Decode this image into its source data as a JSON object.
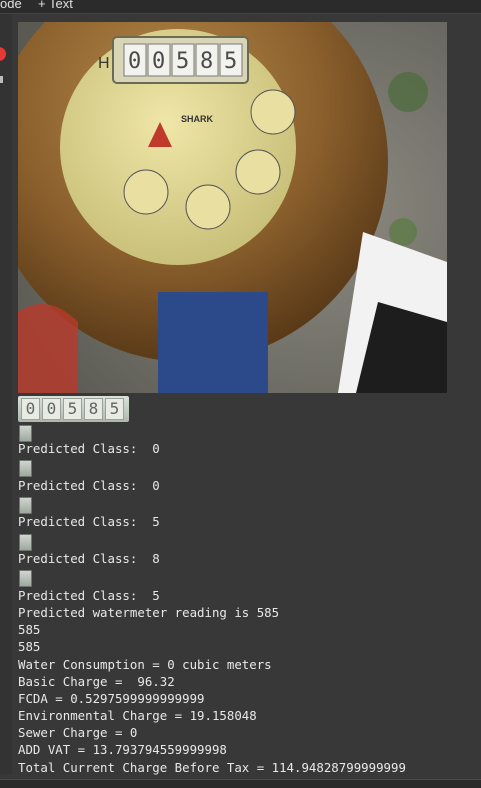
{
  "toolbar": {
    "code_label": "ode",
    "text_label": "+ Text"
  },
  "meter_image": {
    "dial_brand": "SHARK",
    "counter_digits": [
      "0",
      "0",
      "5",
      "8",
      "5"
    ],
    "left_letter": "H"
  },
  "digit_strip": [
    "0",
    "0",
    "5",
    "8",
    "5"
  ],
  "outputs": {
    "pred1": "Predicted Class:  0",
    "pred2": "Predicted Class:  0",
    "pred3": "Predicted Class:  5",
    "pred4": "Predicted Class:  8",
    "pred5": "Predicted Class:  5",
    "reading": "Predicted watermeter reading is 585",
    "echo1": "585",
    "echo2": "585",
    "consumption": "Water Consumption = 0 cubic meters",
    "basic": "Basic Charge =  96.32",
    "fcda": "FCDA = 0.5297599999999999",
    "environmental": "Environmental Charge = 19.158048",
    "sewer": "Sewer Charge = 0",
    "vat": "ADD VAT = 13.793794559999998",
    "total": "Total Current Charge Before Tax = 114.94828799999999"
  }
}
